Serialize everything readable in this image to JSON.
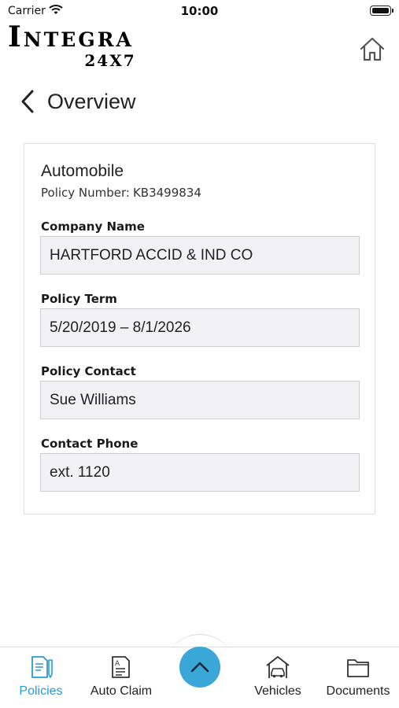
{
  "status_bar": {
    "carrier": "Carrier",
    "time": "10:00"
  },
  "brand": {
    "name": "Integra",
    "sub": "24X7"
  },
  "nav": {
    "title": "Overview"
  },
  "policy": {
    "type": "Automobile",
    "number_label": "Policy Number:",
    "number": "KB3499834",
    "fields": [
      {
        "label": "Company Name",
        "value": "HARTFORD ACCID & IND CO"
      },
      {
        "label": "Policy Term",
        "value": "5/20/2019 – 8/1/2026"
      },
      {
        "label": "Policy Contact",
        "value": "Sue Williams"
      },
      {
        "label": "Contact Phone",
        "value": "ext. 1120"
      }
    ]
  },
  "tab_bar": {
    "active": "Policies",
    "accent_color": "#2a9ad6",
    "fab_color": "#3aa7d8",
    "tabs": [
      {
        "label": "Policies",
        "icon": "policy-document-icon"
      },
      {
        "label": "Auto Claim",
        "icon": "claim-form-icon"
      },
      {
        "label": "Vehicles",
        "icon": "car-garage-icon"
      },
      {
        "label": "Documents",
        "icon": "folder-icon"
      }
    ],
    "center_icon": "chevron-up-icon"
  }
}
